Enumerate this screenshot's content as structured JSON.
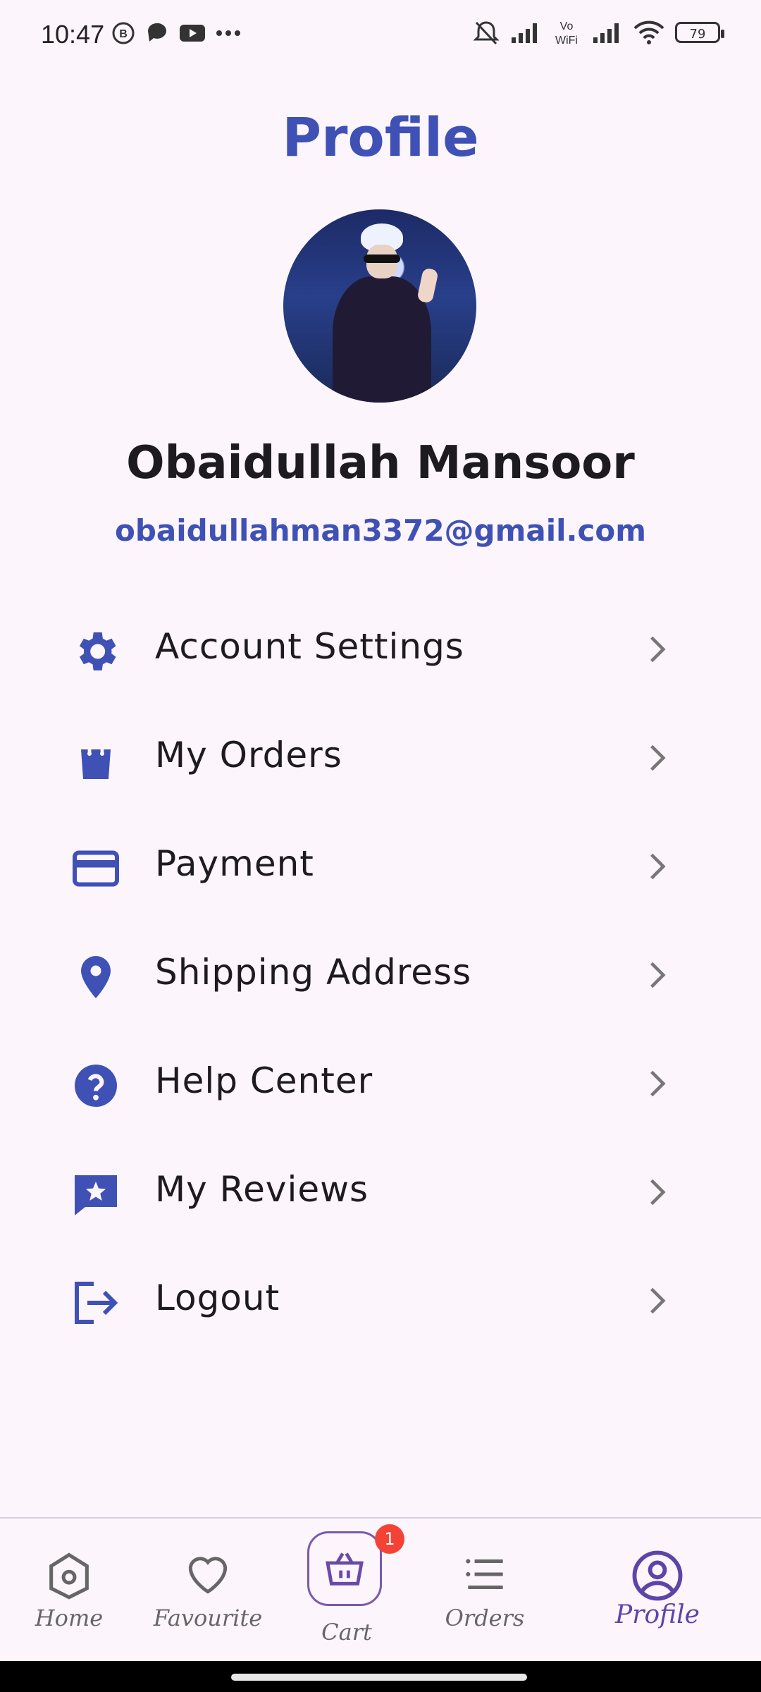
{
  "status_bar": {
    "time": "10:47",
    "battery": "79",
    "left_icons": [
      "b-circle-icon",
      "chat-bubble-icon",
      "youtube-icon",
      "more-dots-icon"
    ],
    "right_icons": [
      "bell-off-icon",
      "signal-icon",
      "vowifi-icon",
      "signal-icon",
      "wifi-icon",
      "battery-icon"
    ],
    "vowifi_label": "Vo WiFi"
  },
  "header": {
    "title": "Profile"
  },
  "user": {
    "name": "Obaidullah Mansoor",
    "email": "obaidullahman3372@gmail.com"
  },
  "colors": {
    "accent": "#3F51B5",
    "background": "#FCF5FC",
    "badge": "#F44336",
    "nav_active": "#5A45A8"
  },
  "menu": [
    {
      "label": "Account Settings",
      "icon": "gear-icon"
    },
    {
      "label": "My Orders",
      "icon": "shopping-bag-icon"
    },
    {
      "label": "Payment",
      "icon": "credit-card-icon"
    },
    {
      "label": "Shipping Address",
      "icon": "location-pin-icon"
    },
    {
      "label": "Help Center",
      "icon": "help-circle-icon"
    },
    {
      "label": "My Reviews",
      "icon": "review-star-icon"
    },
    {
      "label": "Logout",
      "icon": "logout-icon"
    }
  ],
  "bottom_nav": {
    "home": "Home",
    "favourite": "Favourite",
    "cart": "Cart",
    "cart_badge": "1",
    "orders": "Orders",
    "profile": "Profile",
    "active": "Profile"
  }
}
